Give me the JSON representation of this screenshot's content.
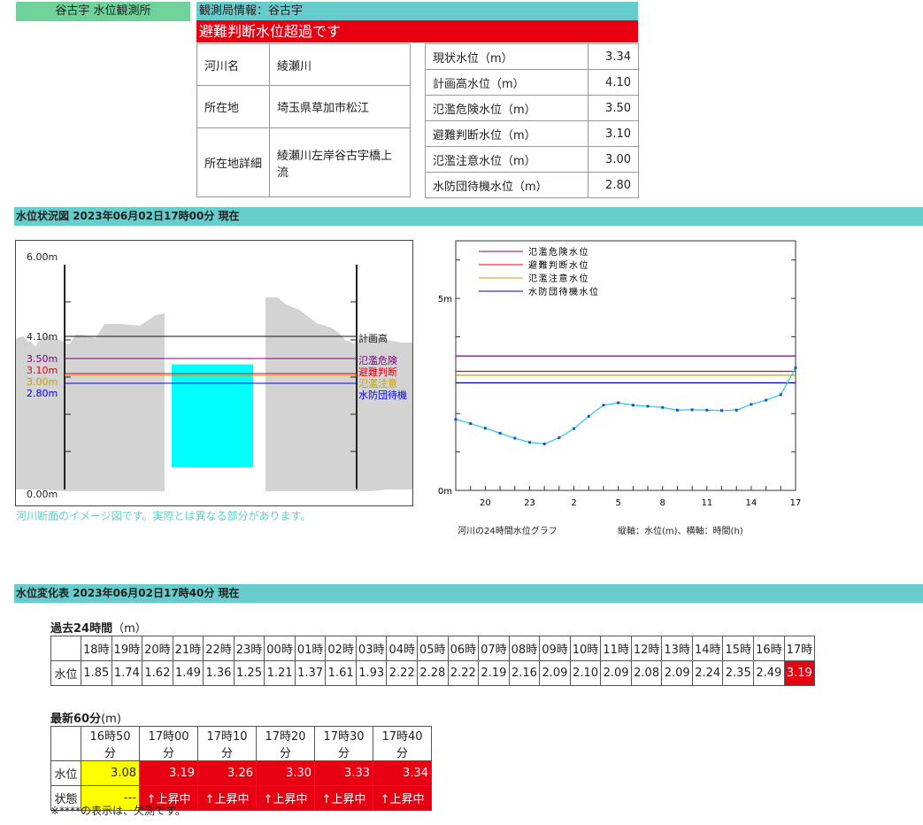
{
  "station_tag": "谷古宇 水位観測所",
  "info_header": "観測局情報：谷古宇",
  "alert": "避難判断水位超過です",
  "info": [
    {
      "label": "河川名",
      "value": "綾瀬川"
    },
    {
      "label": "所在地",
      "value": "埼玉県草加市松江"
    },
    {
      "label": "所在地詳細",
      "value": "綾瀬川左岸谷古宇橋上流"
    }
  ],
  "levels": [
    {
      "label": "現状水位（m）",
      "value": "3.34"
    },
    {
      "label": "計画高水位（m）",
      "value": "4.10"
    },
    {
      "label": "氾濫危険水位（m）",
      "value": "3.50"
    },
    {
      "label": "避難判断水位（m）",
      "value": "3.10"
    },
    {
      "label": "氾濫注意水位（m）",
      "value": "3.00"
    },
    {
      "label": "水防団待機水位（m）",
      "value": "2.80"
    }
  ],
  "status_section_title": "水位状況図 2023年06月02日17時00分 現在",
  "cross_section": {
    "top_label": "6.00m",
    "bottom_label": "0.00m",
    "plan_value_label": "4.10m",
    "plan_name": "計画高",
    "lines": [
      {
        "value_label": "3.50m",
        "name": "氾濫危険",
        "color": "#800080"
      },
      {
        "value_label": "3.10m",
        "name": "避難判断",
        "color": "#e60012"
      },
      {
        "value_label": "3.00m",
        "name": "氾濫注意",
        "color": "#c8a000"
      },
      {
        "value_label": "2.80m",
        "name": "水防団待機",
        "color": "#0000ff"
      }
    ],
    "water_level": 3.34,
    "note": "河川断面のイメージ図です。実際とは異なる部分があります。"
  },
  "chart_data": {
    "type": "line",
    "title": "",
    "xlabel": "",
    "ylabel": "",
    "x": [
      18,
      19,
      20,
      21,
      22,
      23,
      0,
      1,
      2,
      3,
      4,
      5,
      6,
      7,
      8,
      9,
      10,
      11,
      12,
      13,
      14,
      15,
      16,
      17
    ],
    "series": [
      {
        "values": [
          1.85,
          1.74,
          1.62,
          1.49,
          1.36,
          1.25,
          1.21,
          1.37,
          1.61,
          1.93,
          2.22,
          2.28,
          2.22,
          2.19,
          2.16,
          2.09,
          2.1,
          2.09,
          2.08,
          2.09,
          2.24,
          2.35,
          2.49,
          3.19
        ],
        "color": "#33ccdd"
      }
    ],
    "reference_lines": [
      {
        "name": "氾濫危険水位",
        "value": 3.5,
        "color": "#800080"
      },
      {
        "name": "避難判断水位",
        "value": 3.1,
        "color": "#e60012"
      },
      {
        "name": "氾濫注意水位",
        "value": 3.0,
        "color": "#c8a000"
      },
      {
        "name": "水防団待機水位",
        "value": 2.8,
        "color": "#0000a0"
      }
    ],
    "ylim": [
      0,
      6.5
    ],
    "y_tick_labels": [
      "0m",
      "5m"
    ],
    "x_tick_labels": [
      "20",
      "23",
      "2",
      "5",
      "8",
      "11",
      "14",
      "17"
    ],
    "legend": "top-left",
    "caption_left": "河川の24時間水位グラフ",
    "caption_right": "縦軸：水位(m)、横軸：時間(h)"
  },
  "change_section_title": "水位変化表 2023年06月02日17時40分 現在",
  "hist": {
    "title": "過去24時間",
    "unit": "（m）",
    "row_label": "水位",
    "hours": [
      "18時",
      "19時",
      "20時",
      "21時",
      "22時",
      "23時",
      "00時",
      "01時",
      "02時",
      "03時",
      "04時",
      "05時",
      "06時",
      "07時",
      "08時",
      "09時",
      "10時",
      "11時",
      "12時",
      "13時",
      "14時",
      "15時",
      "16時",
      "17時"
    ],
    "values": [
      "1.85",
      "1.74",
      "1.62",
      "1.49",
      "1.36",
      "1.25",
      "1.21",
      "1.37",
      "1.61",
      "1.93",
      "2.22",
      "2.28",
      "2.22",
      "2.19",
      "2.16",
      "2.09",
      "2.10",
      "2.09",
      "2.08",
      "2.09",
      "2.24",
      "2.35",
      "2.49",
      "3.19"
    ]
  },
  "recent": {
    "title": "最新60分",
    "unit": "(m)",
    "row_level": "水位",
    "row_state": "状態",
    "times": [
      "16時50分",
      "17時00分",
      "17時10分",
      "17時20分",
      "17時30分",
      "17時40分"
    ],
    "values": [
      "3.08",
      "3.19",
      "3.26",
      "3.30",
      "3.33",
      "3.34"
    ],
    "states": [
      "---",
      "↑上昇中",
      "↑上昇中",
      "↑上昇中",
      "↑上昇中",
      "↑上昇中"
    ]
  },
  "footnote": "※****の表示は、欠測です。"
}
